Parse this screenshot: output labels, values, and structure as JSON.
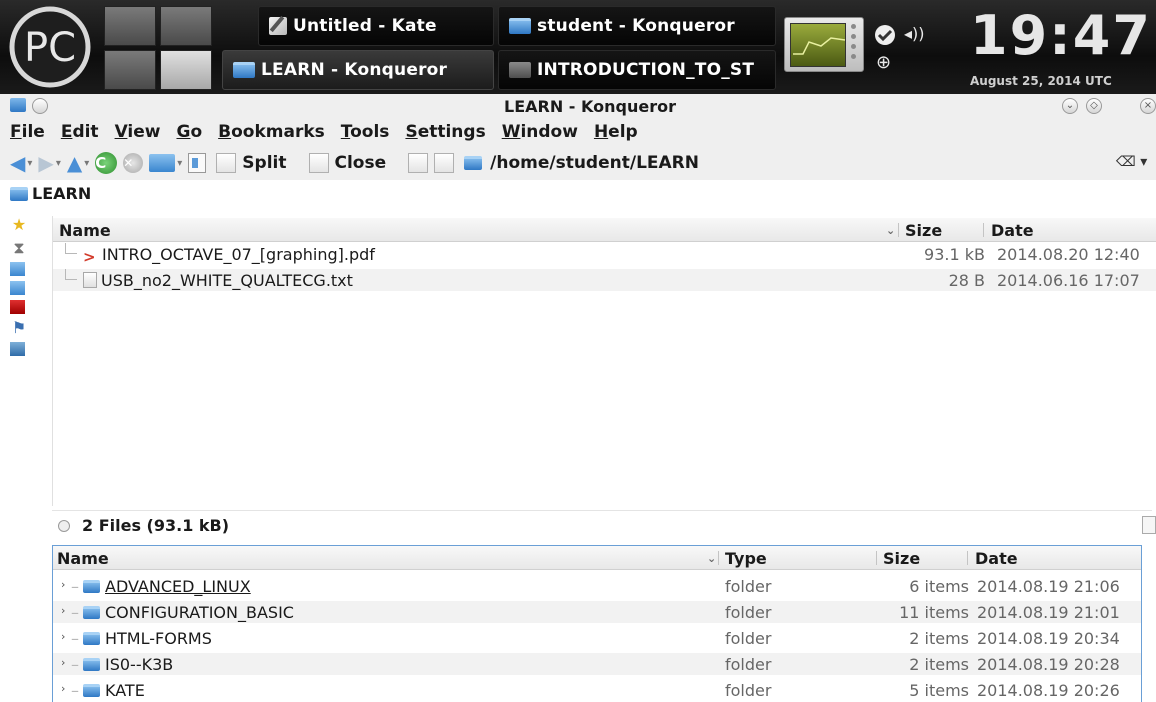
{
  "taskbar": {
    "logo_text": "PC",
    "tasks": [
      {
        "label": "Untitled - Kate",
        "icon": "kate-icon"
      },
      {
        "label": "student - Konqueror",
        "icon": "folder-icon"
      },
      {
        "label": "LEARN - Konqueror",
        "icon": "folder-icon"
      },
      {
        "label": "INTRODUCTION_TO_ST",
        "icon": "terminal-icon"
      }
    ],
    "clock": "19:47",
    "date": "August 25, 2014 UTC"
  },
  "window": {
    "title": "LEARN - Konqueror"
  },
  "menu": [
    "File",
    "Edit",
    "View",
    "Go",
    "Bookmarks",
    "Tools",
    "Settings",
    "Window",
    "Help"
  ],
  "toolbar": {
    "split_label": "Split",
    "close_label": "Close",
    "location": "/home/student/LEARN"
  },
  "breadcrumb": "LEARN",
  "top_pane": {
    "columns": [
      "Name",
      "Size",
      "Date"
    ],
    "rows": [
      {
        "name": "INTRO_OCTAVE_07_[graphing].pdf",
        "size": "93.1 kB",
        "date": "2014.08.20 12:40",
        "icon": "pdf-icon"
      },
      {
        "name": "USB_no2_WHITE_QUALTECG.txt",
        "size": "28 B",
        "date": "2014.06.16 17:07",
        "icon": "text-file-icon"
      }
    ]
  },
  "status": "2 Files (93.1 kB)",
  "bottom_pane": {
    "columns": [
      "Name",
      "Type",
      "Size",
      "Date"
    ],
    "rows": [
      {
        "name": "ADVANCED_LINUX",
        "type": "folder",
        "size": "6 items",
        "date": "2014.08.19 21:06"
      },
      {
        "name": "CONFIGURATION_BASIC",
        "type": "folder",
        "size": "11 items",
        "date": "2014.08.19 21:01"
      },
      {
        "name": "HTML-FORMS",
        "type": "folder",
        "size": "2 items",
        "date": "2014.08.19 20:34"
      },
      {
        "name": "IS0--K3B",
        "type": "folder",
        "size": "2 items",
        "date": "2014.08.19 20:28"
      },
      {
        "name": "KATE",
        "type": "folder",
        "size": "5 items",
        "date": "2014.08.19 20:26"
      }
    ]
  },
  "colors": {
    "accent": "#4a8fd6",
    "panel_bg": "#111111",
    "selection_border": "#6a9fd6"
  }
}
